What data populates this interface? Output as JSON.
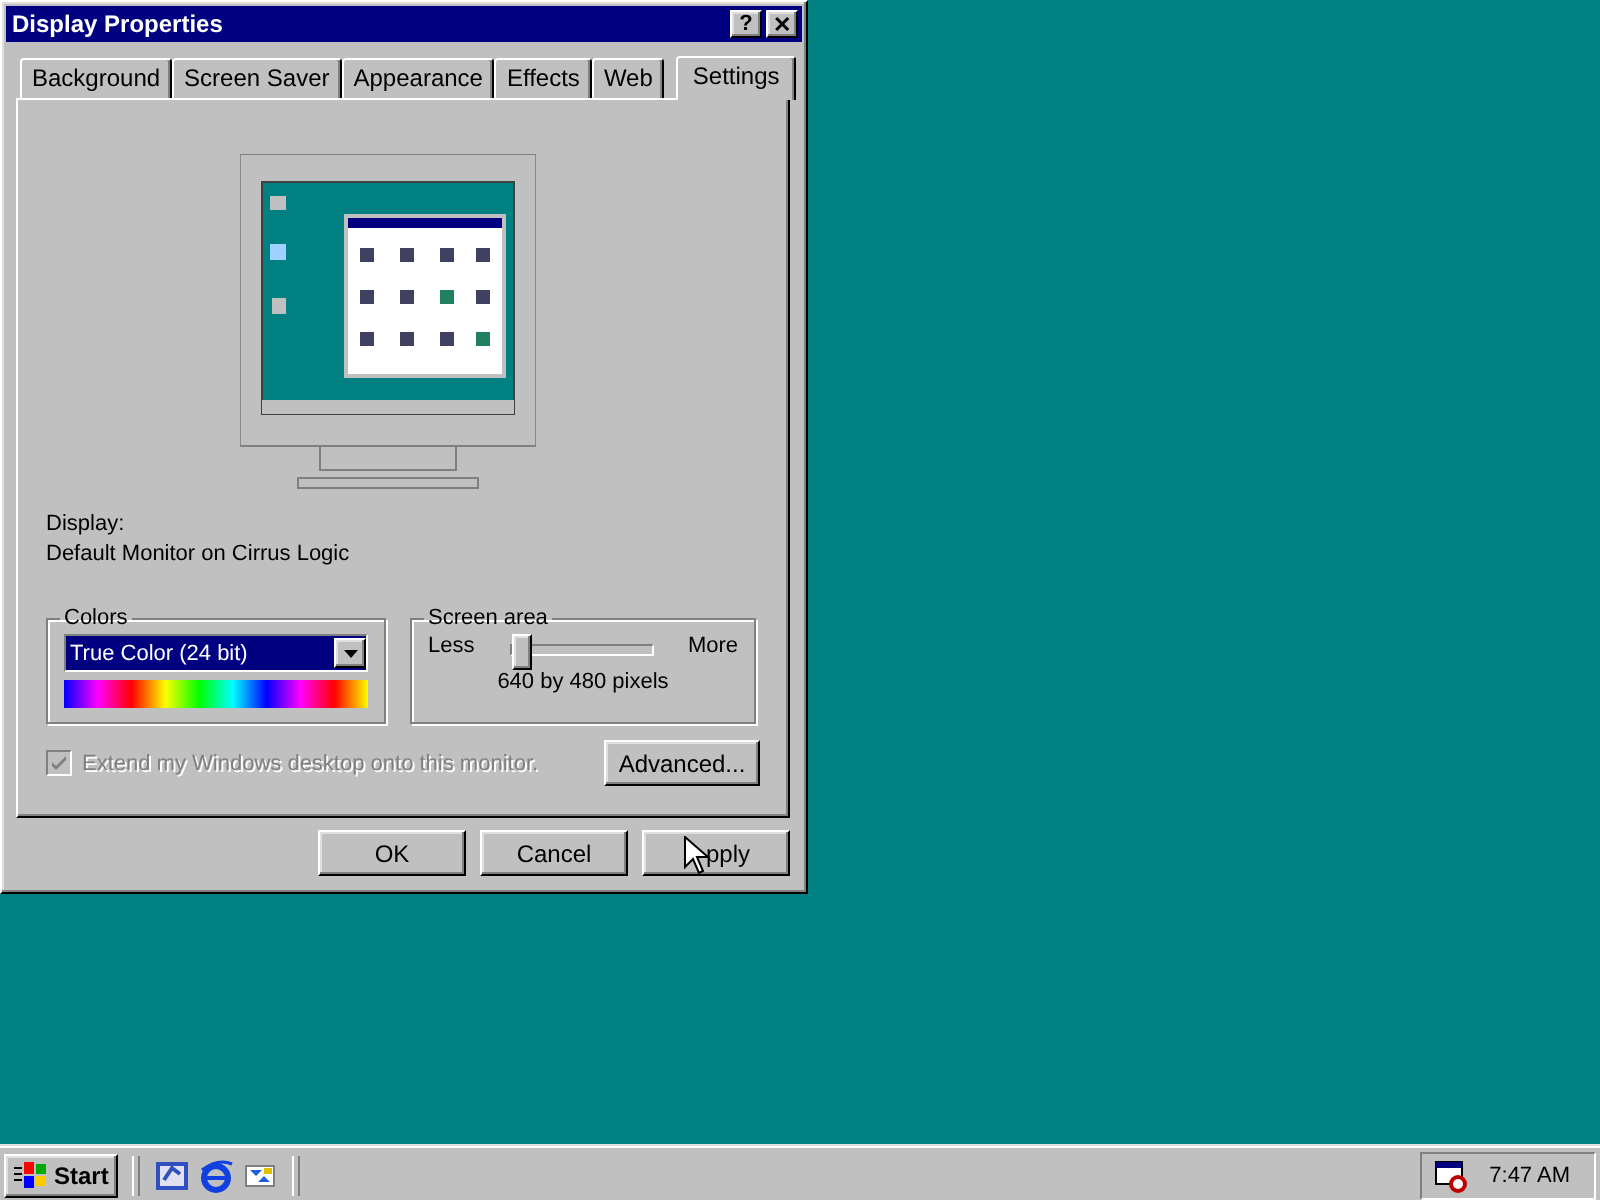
{
  "window": {
    "title": "Display Properties",
    "help_button": "?",
    "close_button": "✕"
  },
  "tabs": [
    {
      "label": "Background",
      "selected": false
    },
    {
      "label": "Screen Saver",
      "selected": false
    },
    {
      "label": "Appearance",
      "selected": false
    },
    {
      "label": "Effects",
      "selected": false
    },
    {
      "label": "Web",
      "selected": false
    },
    {
      "label": "Settings",
      "selected": true
    }
  ],
  "display": {
    "label": "Display:",
    "value": "Default Monitor on Cirrus Logic"
  },
  "colors": {
    "title": "Colors",
    "value": "True Color (24 bit)"
  },
  "screen_area": {
    "title": "Screen area",
    "min_label": "Less",
    "max_label": "More",
    "level": 0,
    "reading": "640 by 480 pixels"
  },
  "extend": {
    "label": "Extend my Windows desktop onto this monitor.",
    "checked": true,
    "disabled": true
  },
  "advanced_button": "Advanced...",
  "buttons": [
    {
      "label": "OK"
    },
    {
      "label": "Cancel"
    },
    {
      "label": "pply"
    }
  ],
  "taskbar": {
    "start": "Start",
    "clock": "7:47 AM"
  }
}
